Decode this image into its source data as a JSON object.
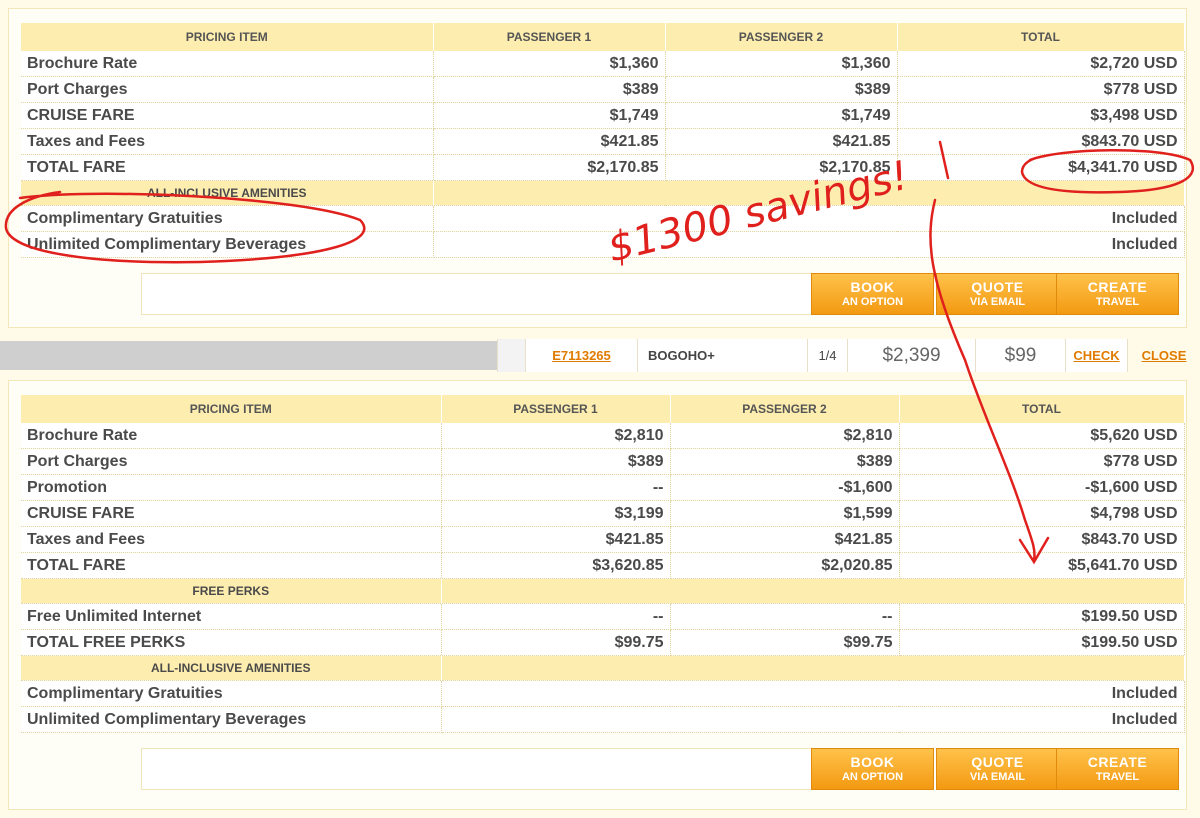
{
  "headers": [
    "PRICING ITEM",
    "PASSENGER 1",
    "PASSENGER 2",
    "TOTAL"
  ],
  "quote1": {
    "rows": [
      {
        "label": "Brochure Rate",
        "p1": "$1,360",
        "p2": "$1,360",
        "total": "$2,720 USD"
      },
      {
        "label": "Port Charges",
        "p1": "$389",
        "p2": "$389",
        "total": "$778 USD"
      },
      {
        "label": "CRUISE FARE",
        "p1": "$1,749",
        "p2": "$1,749",
        "total": "$3,498 USD"
      },
      {
        "label": "Taxes and Fees",
        "p1": "$421.85",
        "p2": "$421.85",
        "total": "$843.70 USD"
      },
      {
        "label": "TOTAL FARE",
        "p1": "$2,170.85",
        "p2": "$2,170.85",
        "total": "$4,341.70 USD"
      }
    ],
    "amenities_title": "ALL-INCLUSIVE AMENITIES",
    "amenities": [
      {
        "label": "Complimentary Gratuities",
        "value": "Included"
      },
      {
        "label": "Unlimited Complimentary Beverages",
        "value": "Included"
      }
    ]
  },
  "midbar": {
    "code": "E7113265",
    "promo": "BOGOHO+",
    "pager": "1/4",
    "price": "$2,399",
    "deposit": "$99",
    "check": "CHECK",
    "close": "CLOSE"
  },
  "quote2": {
    "rows": [
      {
        "label": "Brochure Rate",
        "p1": "$2,810",
        "p2": "$2,810",
        "total": "$5,620 USD"
      },
      {
        "label": "Port Charges",
        "p1": "$389",
        "p2": "$389",
        "total": "$778 USD"
      },
      {
        "label": "Promotion",
        "p1": "--",
        "p2": "-$1,600",
        "total": "-$1,600 USD"
      },
      {
        "label": "CRUISE FARE",
        "p1": "$3,199",
        "p2": "$1,599",
        "total": "$4,798 USD"
      },
      {
        "label": "Taxes and Fees",
        "p1": "$421.85",
        "p2": "$421.85",
        "total": "$843.70 USD"
      },
      {
        "label": "TOTAL FARE",
        "p1": "$3,620.85",
        "p2": "$2,020.85",
        "total": "$5,641.70 USD"
      }
    ],
    "perks_title": "FREE PERKS",
    "perks": [
      {
        "label": "Free Unlimited Internet",
        "p1": "--",
        "p2": "--",
        "total": "$199.50 USD"
      },
      {
        "label": "TOTAL FREE PERKS",
        "p1": "$99.75",
        "p2": "$99.75",
        "total": "$199.50 USD"
      }
    ],
    "amenities_title": "ALL-INCLUSIVE AMENITIES",
    "amenities": [
      {
        "label": "Complimentary Gratuities",
        "value": "Included"
      },
      {
        "label": "Unlimited Complimentary Beverages",
        "value": "Included"
      }
    ]
  },
  "buttons": [
    {
      "line1": "BOOK",
      "line2": "AN OPTION"
    },
    {
      "line1": "QUOTE",
      "line2": "VIA EMAIL"
    },
    {
      "line1": "CREATE",
      "line2": "TRAVEL"
    }
  ],
  "annotation": {
    "savings": "$1300 savings!",
    "color": "#e0201c"
  },
  "colors": {
    "header_bg": "#fdeeb0",
    "button": "#f7a51c",
    "link": "#e07b00"
  }
}
